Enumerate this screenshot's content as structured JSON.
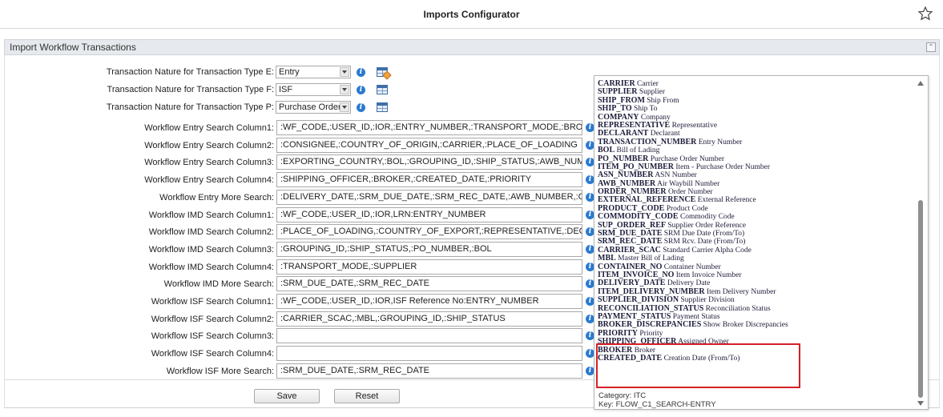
{
  "header": {
    "title": "Imports Configurator",
    "favorite_icon": "star-outline-icon"
  },
  "section": {
    "title": "Import Workflow Transactions",
    "collapse_icon": "double-chevron-up-icon"
  },
  "nature_rows": [
    {
      "label": "Transaction Nature for Transaction Type E:",
      "value": "Entry",
      "grid_icon": "grid-edit-icon"
    },
    {
      "label": "Transaction Nature for Transaction Type F:",
      "value": "ISF",
      "grid_icon": "grid-icon"
    },
    {
      "label": "Transaction Nature for Transaction Type P:",
      "value": "Purchase Order",
      "grid_icon": "grid-icon"
    }
  ],
  "field_rows": [
    {
      "label": "Workflow Entry Search Column1:",
      "value": ":WF_CODE,:USER_ID,:IOR,:ENTRY_NUMBER,:TRANSPORT_MODE,:BROKER_DISCREPANCIES"
    },
    {
      "label": "Workflow Entry Search Column2:",
      "value": ":CONSIGNEE,:COUNTRY_OF_ORIGIN,:CARRIER,:PLACE_OF_LOADING"
    },
    {
      "label": "Workflow Entry Search Column3:",
      "value": ":EXPORTING_COUNTRY,:BOL,:GROUPING_ID,:SHIP_STATUS,:AWB_NUMBER"
    },
    {
      "label": "Workflow Entry Search Column4:",
      "value": ":SHIPPING_OFFICER,:BROKER,:CREATED_DATE,:PRIORITY"
    },
    {
      "label": "Workflow Entry More Search:",
      "value": ":DELIVERY_DATE,:SRM_DUE_DATE,:SRM_REC_DATE,:AWB_NUMBER,:COMPLIANCE_"
    },
    {
      "label": "Workflow IMD Search Column1:",
      "value": ":WF_CODE,:USER_ID,:IOR,LRN:ENTRY_NUMBER"
    },
    {
      "label": "Workflow IMD Search Column2:",
      "value": ":PLACE_OF_LOADING,:COUNTRY_OF_EXPORT,:REPRESENTATIVE,:DECLARANT,:ITEM"
    },
    {
      "label": "Workflow IMD Search Column3:",
      "value": ":GROUPING_ID,:SHIP_STATUS,:PO_NUMBER,:BOL"
    },
    {
      "label": "Workflow IMD Search Column4:",
      "value": ":TRANSPORT_MODE,:SUPPLIER"
    },
    {
      "label": "Workflow IMD More Search:",
      "value": ":SRM_DUE_DATE,:SRM_REC_DATE"
    },
    {
      "label": "Workflow ISF Search Column1:",
      "value": ":WF_CODE,:USER_ID,:IOR,ISF Reference No:ENTRY_NUMBER"
    },
    {
      "label": "Workflow ISF Search Column2:",
      "value": ":CARRIER_SCAC,:MBL,:GROUPING_ID,:SHIP_STATUS"
    },
    {
      "label": "Workflow ISF Search Column3:",
      "value": ""
    },
    {
      "label": "Workflow ISF Search Column4:",
      "value": ""
    },
    {
      "label": "Workflow ISF More Search:",
      "value": ":SRM_DUE_DATE,:SRM_REC_DATE"
    }
  ],
  "buttons": {
    "save": "Save",
    "reset": "Reset"
  },
  "popup": {
    "items": [
      {
        "code": "CARRIER",
        "desc": "Carrier"
      },
      {
        "code": "SUPPLIER",
        "desc": "Supplier"
      },
      {
        "code": "SHIP_FROM",
        "desc": "Ship From"
      },
      {
        "code": "SHIP_TO",
        "desc": "Ship To"
      },
      {
        "code": "COMPANY",
        "desc": "Company"
      },
      {
        "code": "REPRESENTATIVE",
        "desc": "Representative"
      },
      {
        "code": "DECLARANT",
        "desc": "Declarant"
      },
      {
        "code": "TRANSACTION_NUMBER",
        "desc": "Entry Number"
      },
      {
        "code": "BOL",
        "desc": "Bill of Lading"
      },
      {
        "code": "PO_NUMBER",
        "desc": "Purchase Order Number"
      },
      {
        "code": "ITEM_PO_NUMBER",
        "desc": "Item - Purchase Order Number"
      },
      {
        "code": "ASN_NUMBER",
        "desc": "ASN Number"
      },
      {
        "code": "AWB_NUMBER",
        "desc": "Air Waybill Number"
      },
      {
        "code": "ORDER_NUMBER",
        "desc": "Order Number"
      },
      {
        "code": "EXTERNAL_REFERENCE",
        "desc": "External Reference"
      },
      {
        "code": "PRODUCT_CODE",
        "desc": "Product Code"
      },
      {
        "code": "COMMODITY_CODE",
        "desc": "Commodity Code"
      },
      {
        "code": "SUP_ORDER_REF",
        "desc": "Supplier Order Reference"
      },
      {
        "code": "SRM_DUE_DATE",
        "desc": "SRM Due Date (From/To)"
      },
      {
        "code": "SRM_REC_DATE",
        "desc": "SRM Rcv. Date (From/To)"
      },
      {
        "code": "CARRIER_SCAC",
        "desc": "Standard Carrier Alpha Code"
      },
      {
        "code": "MBL",
        "desc": "Master Bill of Lading"
      },
      {
        "code": "CONTAINER_NO",
        "desc": "Container Number"
      },
      {
        "code": "ITEM_INVOICE_NO",
        "desc": "Item Invoice Number"
      },
      {
        "code": "DELIVERY_DATE",
        "desc": "Delivery Date"
      },
      {
        "code": "ITEM_DELIVERY_NUMBER",
        "desc": "Item Delivery Number"
      },
      {
        "code": "SUPPLIER_DIVISION",
        "desc": "Supplier Division"
      },
      {
        "code": "RECONCILIATION_STATUS",
        "desc": "Reconciliation Status"
      },
      {
        "code": "PAYMENT_STATUS",
        "desc": "Payment Status"
      },
      {
        "code": "BROKER_DISCREPANCIES",
        "desc": "Show Broker Discrepancies"
      },
      {
        "code": "PRIORITY",
        "desc": "Priority"
      },
      {
        "code": "SHIPPING_OFFICER",
        "desc": "Assigned Owner"
      },
      {
        "code": "BROKER",
        "desc": "Broker"
      },
      {
        "code": "CREATED_DATE",
        "desc": "Creation Date (From/To)"
      }
    ],
    "category": "Category: ITC",
    "key": "Key: FLOW_C1_SEARCH-ENTRY",
    "highlight_color": "#d62027"
  }
}
